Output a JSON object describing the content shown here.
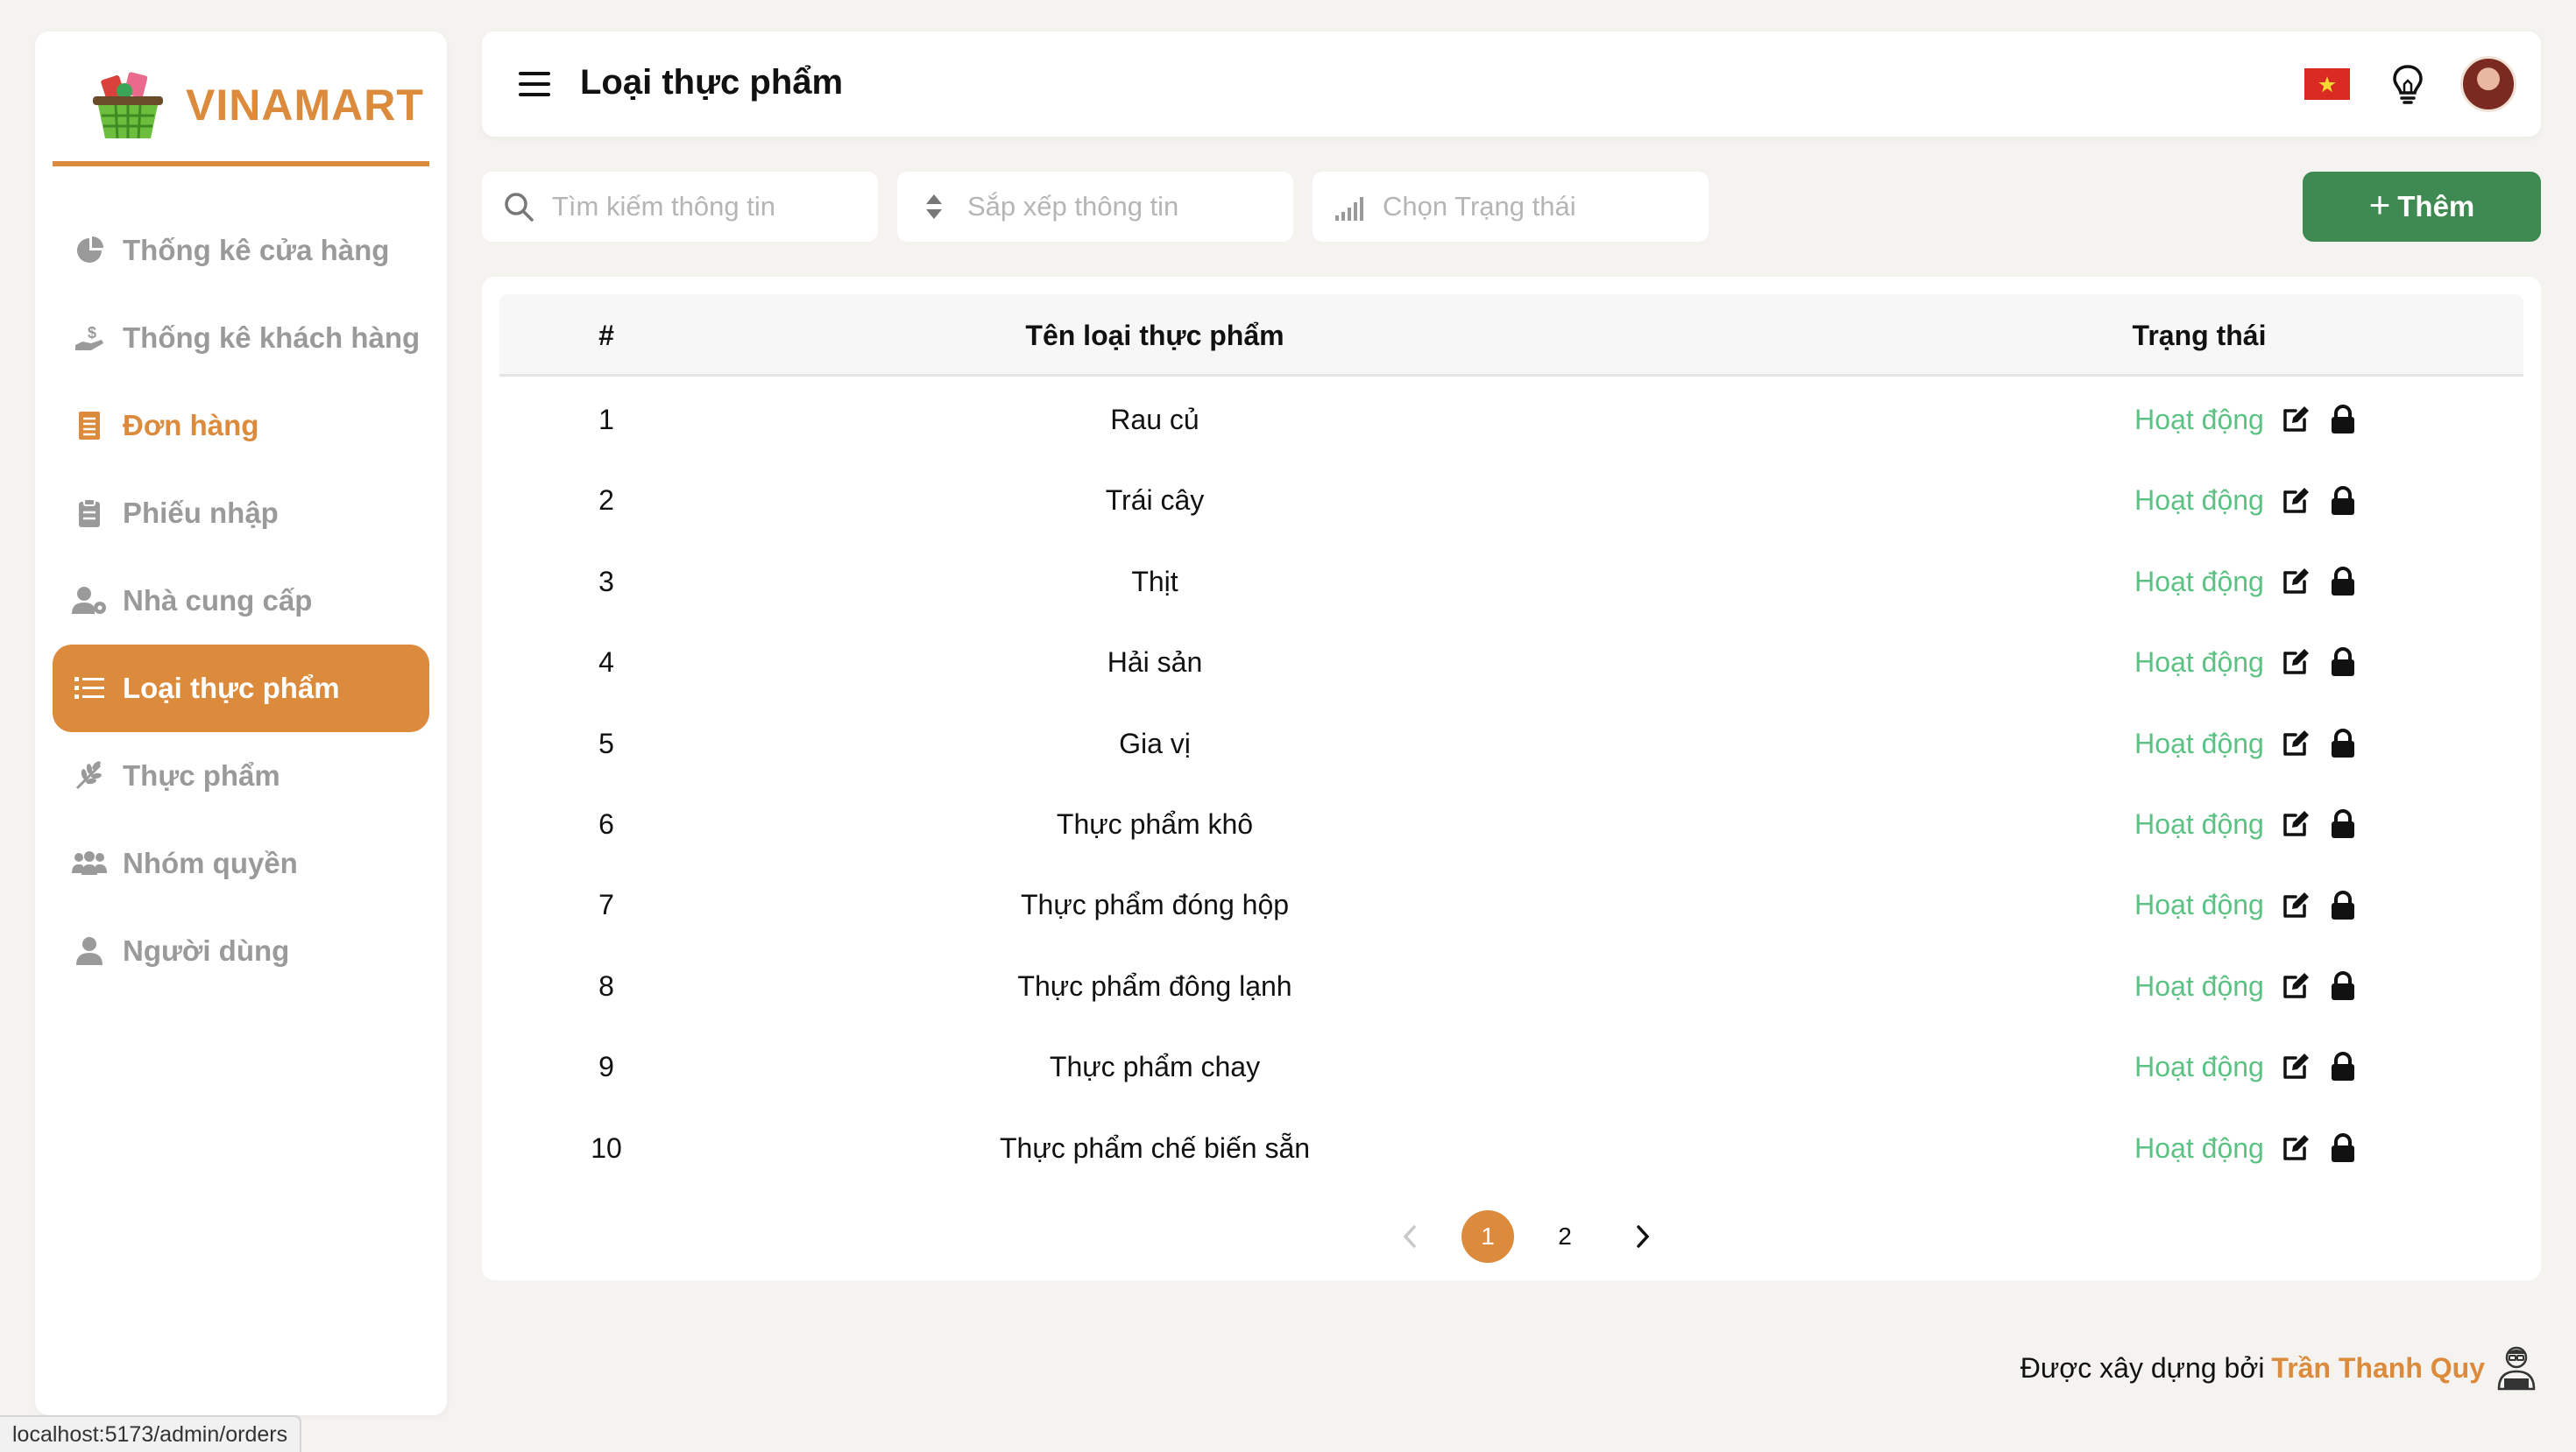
{
  "brand": {
    "name": "VINAMART"
  },
  "sidebar": {
    "items": [
      {
        "label": "Thống kê cửa hàng",
        "icon": "pie-chart-icon",
        "state": "normal"
      },
      {
        "label": "Thống kê khách hàng",
        "icon": "hand-coin-icon",
        "state": "normal"
      },
      {
        "label": "Đơn hàng",
        "icon": "receipt-icon",
        "state": "highlight"
      },
      {
        "label": "Phiếu nhập",
        "icon": "clipboard-icon",
        "state": "normal"
      },
      {
        "label": "Nhà cung cấp",
        "icon": "user-gear-icon",
        "state": "normal"
      },
      {
        "label": "Loại thực phẩm",
        "icon": "list-icon",
        "state": "active"
      },
      {
        "label": "Thực phẩm",
        "icon": "wheat-icon",
        "state": "normal"
      },
      {
        "label": "Nhóm quyền",
        "icon": "users-icon",
        "state": "normal"
      },
      {
        "label": "Người dùng",
        "icon": "user-icon",
        "state": "normal"
      }
    ]
  },
  "header": {
    "title": "Loại thực phẩm"
  },
  "toolbar": {
    "search_placeholder": "Tìm kiếm thông tin",
    "sort_placeholder": "Sắp xếp thông tin",
    "status_placeholder": "Chọn Trạng thái",
    "add_label": "Thêm"
  },
  "table": {
    "headers": {
      "index": "#",
      "name": "Tên loại thực phẩm",
      "status": "Trạng thái"
    },
    "rows": [
      {
        "index": "1",
        "name": "Rau củ",
        "status": "Hoạt động"
      },
      {
        "index": "2",
        "name": "Trái cây",
        "status": "Hoạt động"
      },
      {
        "index": "3",
        "name": "Thịt",
        "status": "Hoạt động"
      },
      {
        "index": "4",
        "name": "Hải sản",
        "status": "Hoạt động"
      },
      {
        "index": "5",
        "name": "Gia vị",
        "status": "Hoạt động"
      },
      {
        "index": "6",
        "name": "Thực phẩm khô",
        "status": "Hoạt động"
      },
      {
        "index": "7",
        "name": "Thực phẩm đóng hộp",
        "status": "Hoạt động"
      },
      {
        "index": "8",
        "name": "Thực phẩm đông lạnh",
        "status": "Hoạt động"
      },
      {
        "index": "9",
        "name": "Thực phẩm chay",
        "status": "Hoạt động"
      },
      {
        "index": "10",
        "name": "Thực phẩm chế biến sẵn",
        "status": "Hoạt động"
      }
    ]
  },
  "pagination": {
    "pages": [
      "1",
      "2"
    ],
    "current": "1"
  },
  "footer": {
    "prefix": "Được xây dựng bởi",
    "author": "Trần Thanh Quy"
  },
  "status_url": "localhost:5173/admin/orders",
  "colors": {
    "accent": "#dc8a3c",
    "add_button": "#3f8a52",
    "status_active": "#5cc283",
    "background": "#f5f3f0"
  }
}
